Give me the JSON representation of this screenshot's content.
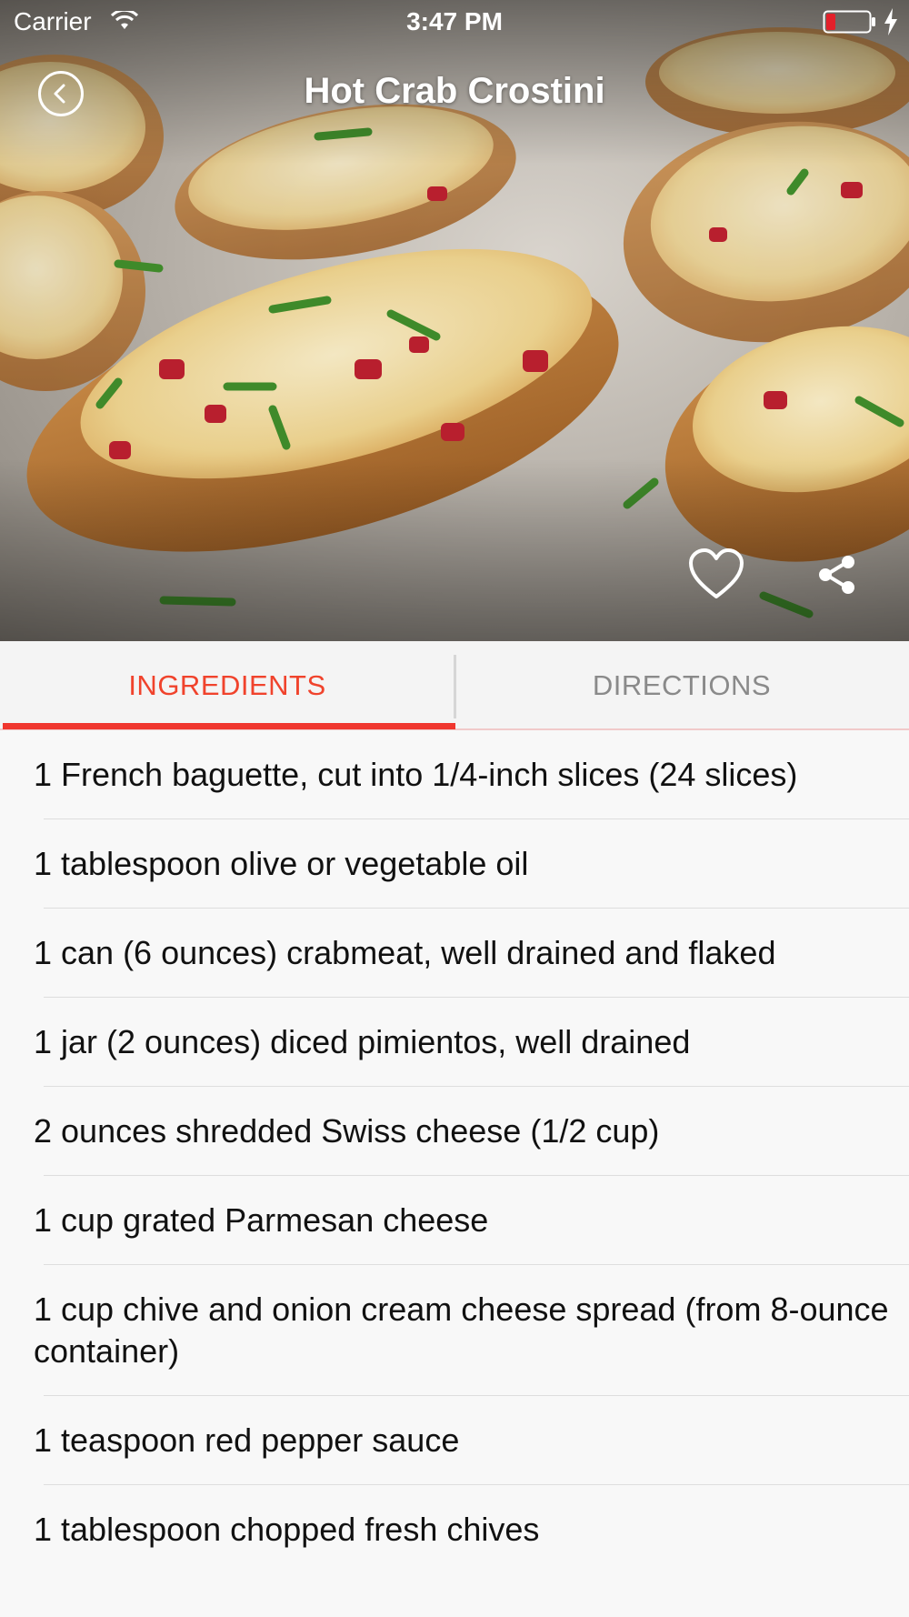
{
  "status_bar": {
    "carrier": "Carrier",
    "time": "3:47 PM",
    "battery_color": "#e3202a"
  },
  "nav": {
    "title": "Hot Crab Crostini",
    "back_icon": "chevron-left-circle-icon"
  },
  "hero": {
    "image_subject": "crab crostini on toasted baguette slices",
    "actions": [
      {
        "name": "favorite",
        "icon": "heart-icon"
      },
      {
        "name": "share",
        "icon": "share-icon"
      }
    ]
  },
  "tabs": {
    "items": [
      {
        "label": "INGREDIENTS",
        "selected": true
      },
      {
        "label": "DIRECTIONS",
        "selected": false
      }
    ],
    "accent_color": "#f0362e"
  },
  "ingredients": [
    "1 French baguette, cut into 1/4-inch slices (24 slices)",
    "1 tablespoon olive or vegetable oil",
    "1 can (6 ounces) crabmeat, well drained and flaked",
    "1 jar (2 ounces) diced pimientos, well drained",
    "2 ounces shredded Swiss cheese (1/2 cup)",
    "1 cup grated Parmesan cheese",
    "1 cup chive and onion cream cheese spread (from 8-ounce container)",
    "1 teaspoon red pepper sauce",
    "1 tablespoon chopped fresh chives"
  ]
}
